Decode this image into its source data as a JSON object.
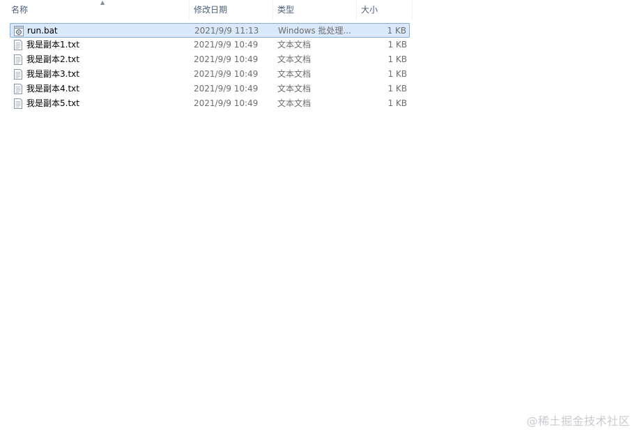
{
  "columns": {
    "name": "名称",
    "modified": "修改日期",
    "type": "类型",
    "size": "大小"
  },
  "files": [
    {
      "name": "run.bat",
      "modified": "2021/9/9 11:13",
      "type": "Windows 批处理...",
      "size": "1 KB",
      "icon": "batch-file-icon",
      "selected": true
    },
    {
      "name": "我是副本1.txt",
      "modified": "2021/9/9 10:49",
      "type": "文本文档",
      "size": "1 KB",
      "icon": "text-file-icon",
      "selected": false
    },
    {
      "name": "我是副本2.txt",
      "modified": "2021/9/9 10:49",
      "type": "文本文档",
      "size": "1 KB",
      "icon": "text-file-icon",
      "selected": false
    },
    {
      "name": "我是副本3.txt",
      "modified": "2021/9/9 10:49",
      "type": "文本文档",
      "size": "1 KB",
      "icon": "text-file-icon",
      "selected": false
    },
    {
      "name": "我是副本4.txt",
      "modified": "2021/9/9 10:49",
      "type": "文本文档",
      "size": "1 KB",
      "icon": "text-file-icon",
      "selected": false
    },
    {
      "name": "我是副本5.txt",
      "modified": "2021/9/9 10:49",
      "type": "文本文档",
      "size": "1 KB",
      "icon": "text-file-icon",
      "selected": false
    }
  ],
  "watermark": "@稀土掘金技术社区",
  "colors": {
    "selection_bg": "#d9e8fb",
    "selection_border": "#84acdd",
    "header_text": "#4c607a"
  }
}
